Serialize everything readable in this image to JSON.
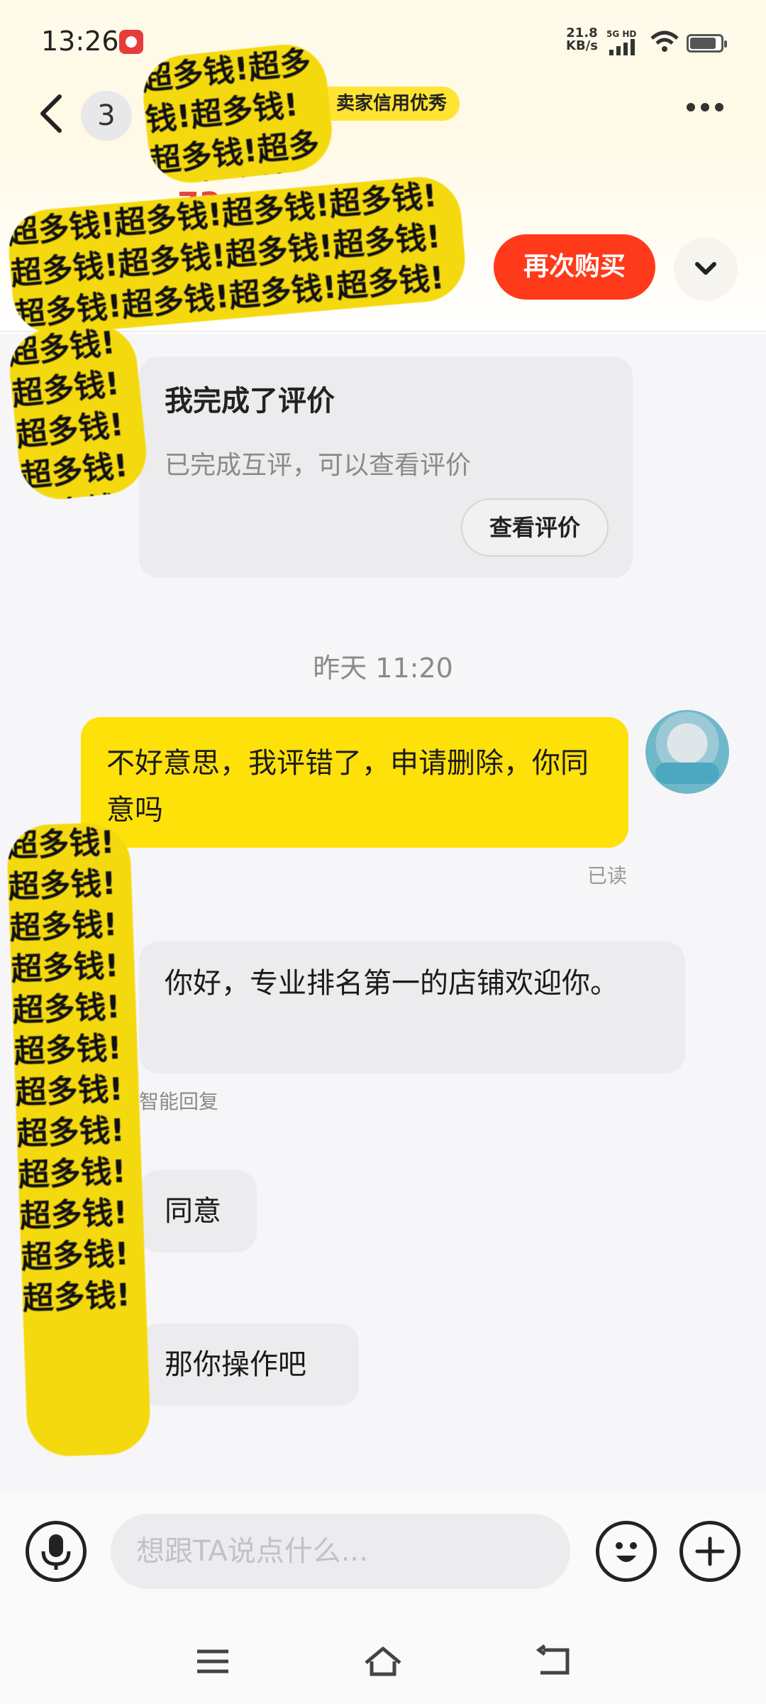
{
  "status_bar": {
    "time": "13:26",
    "net_speed": "21.8",
    "net_unit": "KB/s",
    "network": "5G HD"
  },
  "header": {
    "back_count": "3",
    "seller_tag": "卖家信用优秀",
    "price_fragment": "73",
    "rebuy_label": "再次购买"
  },
  "review_card": {
    "title": "我完成了评价",
    "subtitle": "已完成互评，可以查看评价",
    "button": "查看评价"
  },
  "timestamp": "昨天 11:20",
  "messages": [
    {
      "from": "me",
      "text": "不好意思，我评错了，申请删除，你同意吗",
      "status": "已读"
    },
    {
      "from": "seller",
      "text": "你好，专业排名第一的店铺欢迎你。",
      "note": "智能回复"
    },
    {
      "from": "seller",
      "text": "同意"
    },
    {
      "from": "seller",
      "text": "那你操作吧"
    }
  ],
  "input": {
    "placeholder": "想跟TA说点什么..."
  },
  "watermark_text": "超多钱!超多钱!超多钱!超多钱!超多钱!超多钱!超多钱!超多钱!超多钱!超多钱!超多钱!超多钱!",
  "colors": {
    "accent_yellow": "#ffe10a",
    "rebuy_red": "#ff3a1a",
    "price_red": "#e84343"
  },
  "icons": [
    "back-icon",
    "more-icon",
    "chevron-down-icon",
    "mic-icon",
    "emoji-icon",
    "plus-icon",
    "menu-icon",
    "home-icon",
    "return-icon"
  ]
}
